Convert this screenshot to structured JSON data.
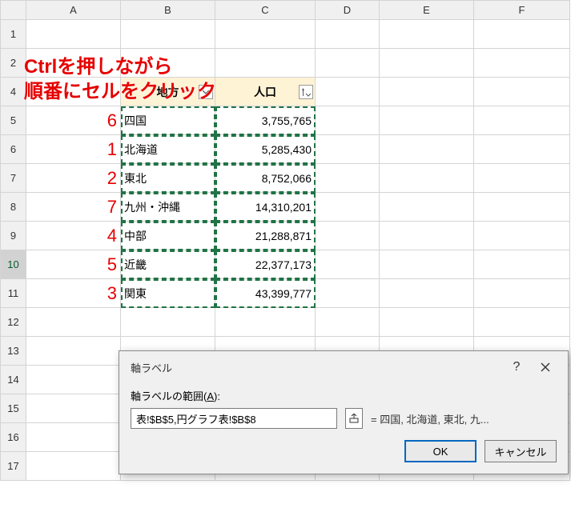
{
  "columns": [
    "A",
    "B",
    "C",
    "D",
    "E",
    "F"
  ],
  "rowNumbers": [
    "1",
    "2",
    "4",
    "5",
    "6",
    "7",
    "8",
    "9",
    "10",
    "11",
    "12",
    "13",
    "14",
    "15",
    "16",
    "17"
  ],
  "instruction": "Ctrlを押しながら\n順番にセルをクリック",
  "header": {
    "region": "地方",
    "pop": "人口"
  },
  "rows": [
    {
      "order": "6",
      "region": "四国",
      "pop": "3,755,765"
    },
    {
      "order": "1",
      "region": "北海道",
      "pop": "5,285,430"
    },
    {
      "order": "2",
      "region": "東北",
      "pop": "8,752,066"
    },
    {
      "order": "7",
      "region": "九州・沖縄",
      "pop": "14,310,201"
    },
    {
      "order": "4",
      "region": "中部",
      "pop": "21,288,871"
    },
    {
      "order": "5",
      "region": "近畿",
      "pop": "22,377,173"
    },
    {
      "order": "3",
      "region": "関東",
      "pop": "43,399,777"
    }
  ],
  "dialog": {
    "title": "軸ラベル",
    "label_prefix": "軸ラベルの範囲(",
    "label_key": "A",
    "label_suffix": "):",
    "input": "表!$B$5,円グラフ表!$B$8",
    "preview": "= 四国, 北海道, 東北, 九...",
    "ok": "OK",
    "cancel": "キャンセル"
  },
  "chart_data": {
    "type": "table",
    "columns": [
      "地方",
      "人口"
    ],
    "rows": [
      [
        "四国",
        3755765
      ],
      [
        "北海道",
        5285430
      ],
      [
        "東北",
        8752066
      ],
      [
        "九州・沖縄",
        14310201
      ],
      [
        "中部",
        21288871
      ],
      [
        "近畿",
        22377173
      ],
      [
        "関東",
        43399777
      ]
    ]
  }
}
